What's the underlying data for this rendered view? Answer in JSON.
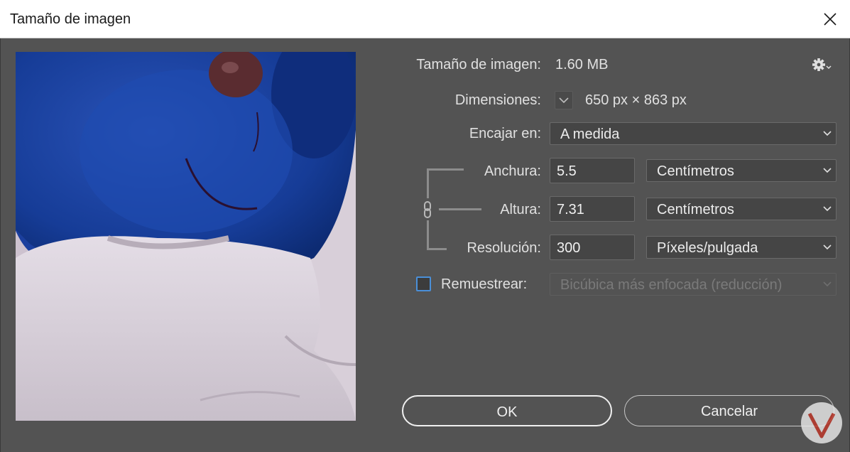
{
  "window": {
    "title": "Tamaño de imagen"
  },
  "info": {
    "size_label": "Tamaño de imagen:",
    "size_value": "1.60 MB",
    "dimensions_label": "Dimensiones:",
    "dimensions_value": "650 px × 863 px"
  },
  "fit": {
    "label": "Encajar en:",
    "value": "A medida"
  },
  "width": {
    "label": "Anchura:",
    "value": "5.5",
    "unit": "Centímetros"
  },
  "height": {
    "label": "Altura:",
    "value": "7.31",
    "unit": "Centímetros"
  },
  "resolution": {
    "label": "Resolución:",
    "value": "300",
    "unit": "Píxeles/pulgada"
  },
  "resample": {
    "label": "Remuestrear:",
    "checked": false,
    "method": "Bicúbica más enfocada (reducción)"
  },
  "buttons": {
    "ok": "OK",
    "cancel": "Cancelar"
  },
  "icons": {
    "settings": "gear-icon",
    "close": "close-icon",
    "link": "chain-link-icon",
    "dropdown": "chevron-down-icon"
  },
  "colors": {
    "background": "#535353",
    "checkbox_accent": "#4a8fd8"
  }
}
